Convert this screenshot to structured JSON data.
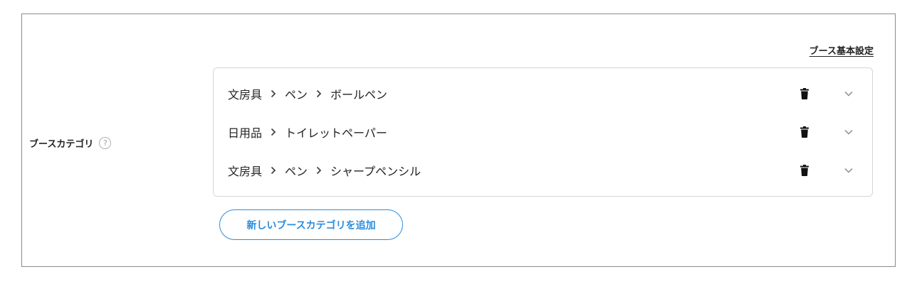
{
  "header": {
    "settings_link": "ブース基本設定"
  },
  "field": {
    "label": "ブースカテゴリ",
    "help_icon": "question-circle-icon",
    "help_glyph": "?"
  },
  "categories": [
    {
      "path": [
        "文房具",
        "ペン",
        "ボールペン"
      ]
    },
    {
      "path": [
        "日用品",
        "トイレットペーパー"
      ]
    },
    {
      "path": [
        "文房具",
        "ペン",
        "シャープペンシル"
      ]
    }
  ],
  "row_icons": {
    "separator": "chevron-right-icon",
    "delete": "trash-icon",
    "expand": "chevron-down-icon"
  },
  "add_button": {
    "label": "新しいブースカテゴリを追加"
  },
  "colors": {
    "accent": "#2a8dde",
    "text": "#222222",
    "border": "#d6d6d6",
    "frame_border": "#8a8a8a",
    "muted_icon": "#999999"
  }
}
